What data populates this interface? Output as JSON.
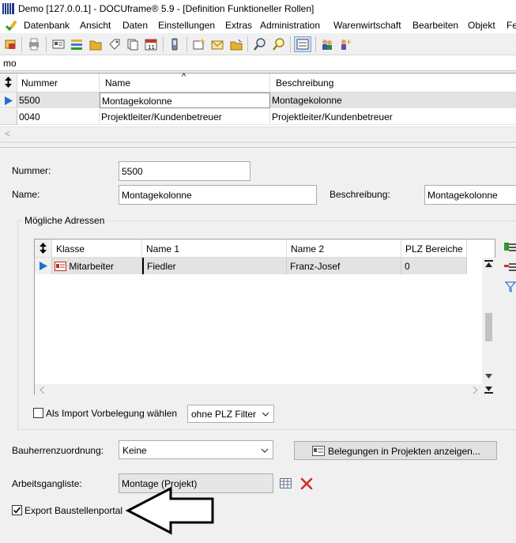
{
  "window": {
    "title": "Demo [127.0.0.1] - DOCUframe® 5.9 - [Definition Funktioneller Rollen]"
  },
  "menu": {
    "items": [
      "Datenbank",
      "Ansicht",
      "Daten",
      "Einstellungen",
      "Extras",
      "Administration",
      "Warenwirtschaft",
      "Bearbeiten",
      "Objekt",
      "Fe"
    ]
  },
  "toolbar": {
    "icons": [
      "properties-icon",
      "print-icon",
      "card-icon",
      "list-icon",
      "folder-icon",
      "tag-icon",
      "copy-icon",
      "calendar-icon",
      "phone-icon",
      "new-item-icon",
      "envelope-icon",
      "folder-open-icon",
      "search-icon",
      "search-highlight-icon",
      "view-icon",
      "users-icon",
      "user-switch-icon"
    ]
  },
  "filter": {
    "value": "mo"
  },
  "top_grid": {
    "columns": [
      "Nummer",
      "Name",
      "Beschreibung"
    ],
    "sort_indicator": "^",
    "rows": [
      {
        "nummer": "5500",
        "name": "Montagekolonne",
        "beschreibung": "Montagekolonne"
      },
      {
        "nummer": "0040",
        "name": "Projektleiter/Kundenbetreuer",
        "beschreibung": "Projektleiter/Kundenbetreuer"
      }
    ],
    "hscroll_arrow": "<"
  },
  "form": {
    "nummer_label": "Nummer:",
    "nummer_value": "5500",
    "name_label": "Name:",
    "name_value": "Montagekolonne",
    "beschreibung_label": "Beschreibung:",
    "beschreibung_value": "Montagekolonne",
    "group_title": "Mögliche Adressen",
    "sub_grid": {
      "columns": [
        "Klasse",
        "Name 1",
        "Name 2",
        "PLZ Bereiche"
      ],
      "rows": [
        {
          "klasse": "Mitarbeiter",
          "name1": "Fiedler",
          "name2": "Franz-Josef",
          "plz": "0"
        }
      ]
    },
    "import_checkbox_label": "Als Import Vorbelegung wählen",
    "import_checked": false,
    "plz_filter_value": "ohne PLZ Filter",
    "bauherren_label": "Bauherrenzuordnung:",
    "bauherren_value": "Keine",
    "belegungen_button": "Belegungen in Projekten anzeigen...",
    "arbeitsgang_label": "Arbeitsgangliste:",
    "arbeitsgang_value": "Montage (Projekt)",
    "export_label": "Export Baustellenportal",
    "export_checked": true
  },
  "colors": {
    "accent_blue": "#1f6fd0",
    "delete_red": "#d03020",
    "add_green": "#2a9a2a",
    "selection_gray": "#e3e3e3"
  }
}
